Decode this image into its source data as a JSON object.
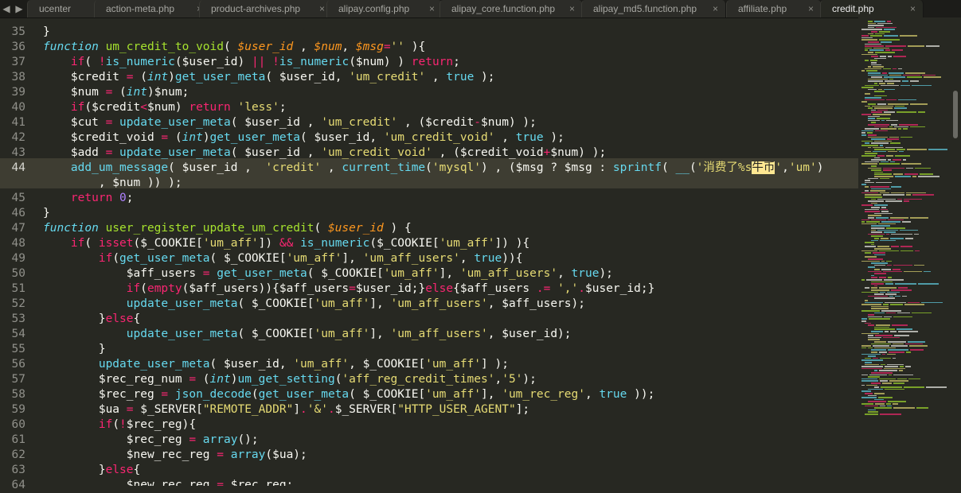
{
  "tabs": [
    {
      "label": "ucenter",
      "close": "",
      "active": false
    },
    {
      "label": "action-meta.php",
      "close": "×",
      "active": false
    },
    {
      "label": "product-archives.php",
      "close": "×",
      "active": false
    },
    {
      "label": "alipay.config.php",
      "close": "×",
      "active": false
    },
    {
      "label": "alipay_core.function.php",
      "close": "×",
      "active": false
    },
    {
      "label": "alipay_md5.function.php",
      "close": "×",
      "active": false
    },
    {
      "label": "affiliate.php",
      "close": "×",
      "active": false
    },
    {
      "label": "credit.php",
      "close": "×",
      "active": true
    }
  ],
  "nav": {
    "left": "◀",
    "right": "▶"
  },
  "editor": {
    "lines": [
      {
        "n": "35",
        "rows": [
          "}"
        ]
      },
      {
        "n": "36",
        "rows": [
          "function um_credit_to_void( $user_id , $num, $msg='' ){"
        ]
      },
      {
        "n": "37",
        "rows": [
          "    if( !is_numeric($user_id) || !is_numeric($num) ) return;"
        ]
      },
      {
        "n": "38",
        "rows": [
          "    $credit = (int)get_user_meta( $user_id, 'um_credit' , true );"
        ]
      },
      {
        "n": "39",
        "rows": [
          "    $num = (int)$num;"
        ]
      },
      {
        "n": "40",
        "rows": [
          "    if($credit<$num) return 'less';"
        ]
      },
      {
        "n": "41",
        "rows": [
          "    $cut = update_user_meta( $user_id , 'um_credit' , ($credit-$num) );"
        ]
      },
      {
        "n": "42",
        "rows": [
          "    $credit_void = (int)get_user_meta( $user_id, 'um_credit_void' , true );"
        ]
      },
      {
        "n": "43",
        "rows": [
          "    $add = update_user_meta( $user_id , 'um_credit_void' , ($credit_void+$num) );"
        ]
      },
      {
        "n": "44",
        "rows": [
          "    add_um_message( $user_id ,  'credit' , current_time('mysql') , ($msg ? $msg : sprintf( __('消费了%s牛币','um')",
          "        , $num )) );"
        ]
      },
      {
        "n": "45",
        "rows": [
          "    return 0;"
        ]
      },
      {
        "n": "46",
        "rows": [
          "}"
        ]
      },
      {
        "n": "47",
        "rows": [
          "function user_register_update_um_credit( $user_id ) {"
        ]
      },
      {
        "n": "48",
        "rows": [
          "    if( isset($_COOKIE['um_aff']) && is_numeric($_COOKIE['um_aff']) ){"
        ]
      },
      {
        "n": "49",
        "rows": [
          "        if(get_user_meta( $_COOKIE['um_aff'], 'um_aff_users', true)){"
        ]
      },
      {
        "n": "50",
        "rows": [
          "            $aff_users = get_user_meta( $_COOKIE['um_aff'], 'um_aff_users', true);"
        ]
      },
      {
        "n": "51",
        "rows": [
          "            if(empty($aff_users)){$aff_users=$user_id;}else{$aff_users .= ','.$user_id;}"
        ]
      },
      {
        "n": "52",
        "rows": [
          "            update_user_meta( $_COOKIE['um_aff'], 'um_aff_users', $aff_users);"
        ]
      },
      {
        "n": "53",
        "rows": [
          "        }else{"
        ]
      },
      {
        "n": "54",
        "rows": [
          "            update_user_meta( $_COOKIE['um_aff'], 'um_aff_users', $user_id);"
        ]
      },
      {
        "n": "55",
        "rows": [
          "        }"
        ]
      },
      {
        "n": "56",
        "rows": [
          "        update_user_meta( $user_id, 'um_aff', $_COOKIE['um_aff'] );"
        ]
      },
      {
        "n": "57",
        "rows": [
          "        $rec_reg_num = (int)um_get_setting('aff_reg_credit_times','5');"
        ]
      },
      {
        "n": "58",
        "rows": [
          "        $rec_reg = json_decode(get_user_meta( $_COOKIE['um_aff'], 'um_rec_reg', true ));"
        ]
      },
      {
        "n": "59",
        "rows": [
          "        $ua = $_SERVER[\"REMOTE_ADDR\"].'&'.$_SERVER[\"HTTP_USER_AGENT\"];"
        ]
      },
      {
        "n": "60",
        "rows": [
          "        if(!$rec_reg){"
        ]
      },
      {
        "n": "61",
        "rows": [
          "            $rec_reg = array();"
        ]
      },
      {
        "n": "62",
        "rows": [
          "            $new_rec_reg = array($ua);"
        ]
      },
      {
        "n": "63",
        "rows": [
          "        }else{"
        ]
      },
      {
        "n": "64",
        "rows": [
          "            $new_rec_reg = $rec_reg;"
        ]
      }
    ],
    "current_line": "44",
    "highlight_text": "牛币"
  },
  "colors": {
    "background": "#272822",
    "keyword": "#f92672",
    "storage": "#66d9ef",
    "function_name": "#a6e22e",
    "string": "#e6db74",
    "number": "#ae81ff",
    "parameter": "#fd971f",
    "line_highlight": "#3e3d32",
    "find_highlight": "#ffe792"
  }
}
